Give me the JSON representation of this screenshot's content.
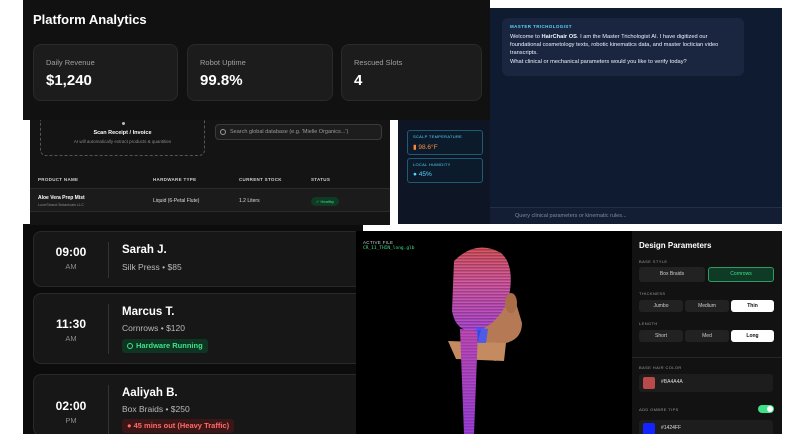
{
  "analytics": {
    "title": "Platform Analytics",
    "stats": [
      {
        "label": "Daily Revenue",
        "value": "$1,240"
      },
      {
        "label": "Robot Uptime",
        "value": "99.8%"
      },
      {
        "label": "Rescued Slots",
        "value": "4"
      }
    ]
  },
  "inventory": {
    "scan_title": "Scan Receipt / Invoice",
    "scan_subtitle": "AI will automatically extract products & quantities",
    "search_placeholder": "Search global database (e.g. 'Mielle Organics...')",
    "columns": [
      "PRODUCT NAME",
      "HARDWARE TYPE",
      "CURRENT STOCK",
      "STATUS"
    ],
    "rows": [
      {
        "product": "Aloe Vera Prep Mist",
        "brand": "LuxeStrand Botanicals LLC",
        "hardware": "Liquid (6-Petal Flute)",
        "stock": "1.2 Liters",
        "status": "Healthy"
      }
    ]
  },
  "assistant": {
    "header": "MASTER TRICHOLOGIST",
    "message_pre": "Welcome to ",
    "message_bold": "HairChair OS",
    "message_post": ". I am the Master Trichologist AI. I have digitized our foundational cosmetology texts, robotic kinematics data, and master loctician video transcripts.",
    "message_question": "What clinical or mechanical parameters would you like to verify today?",
    "input_placeholder": "Query clinical parameters or kinematic rules...",
    "sensors": [
      {
        "label": "SCALP TEMPERATURE",
        "value": "98.6°F",
        "icon": "thermometer-icon"
      },
      {
        "label": "LOCAL HUMIDITY",
        "value": "45%",
        "icon": "droplet-icon"
      }
    ]
  },
  "appointments": [
    {
      "time": "09:00",
      "ampm": "AM",
      "name": "Sarah J.",
      "service": "Silk Press • $85"
    },
    {
      "time": "11:30",
      "ampm": "AM",
      "name": "Marcus T.",
      "service": "Cornrows • $120",
      "status": "Hardware Running",
      "status_icon": "check-circle-icon"
    },
    {
      "time": "02:00",
      "ampm": "PM",
      "name": "Aaliyah B.",
      "service": "Box Braids • $250",
      "status": "45 mins out (Heavy Traffic)",
      "status_icon": "map-pin-icon"
    }
  ],
  "viewer": {
    "active_file_label": "ACTIVE FILE",
    "active_file_value": "CR_11_THIN_long.glb"
  },
  "design": {
    "title": "Design Parameters",
    "base_style_label": "BASE STYLE",
    "base_styles": [
      "Box Braids",
      "Cornrows"
    ],
    "base_style_selected": "Cornrows",
    "thickness_label": "THICKNESS",
    "thickness": [
      "Jumbo",
      "Medium",
      "Thin"
    ],
    "thickness_selected": "Thin",
    "length_label": "LENGTH",
    "lengths": [
      "Short",
      "Med",
      "Long"
    ],
    "length_selected": "Long",
    "base_color_label": "BASE HAIR COLOR",
    "base_color": "#BA4A4A",
    "ombre_label": "ADD OMBRE TIPS",
    "ombre_enabled": true,
    "ombre_color": "#1424FF"
  },
  "colors": {
    "accent_green": "#3ee08a",
    "accent_cyan": "#5ad5ff",
    "alert_red": "#ff6b6b"
  }
}
